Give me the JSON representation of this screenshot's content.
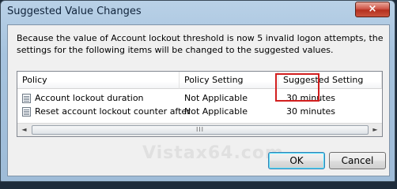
{
  "window": {
    "title": "Suggested Value Changes",
    "close_glyph": "×"
  },
  "message": "Because the value of Account lockout threshold is now 5 invalid logon attempts, the settings for the following items will be changed to the suggested values.",
  "table": {
    "columns": [
      "Policy",
      "Policy Setting",
      "Suggested Setting"
    ],
    "rows": [
      {
        "policy": "Account lockout duration",
        "setting": "Not Applicable",
        "suggested": "30 minutes"
      },
      {
        "policy": "Reset account lockout counter after",
        "setting": "Not Applicable",
        "suggested": "30 minutes"
      }
    ],
    "scroll_left": "◄",
    "scroll_right": "►",
    "scroll_grip": "III"
  },
  "watermark": "Vistax64.com",
  "buttons": {
    "ok": "OK",
    "cancel": "Cancel"
  },
  "colors": {
    "highlight": "#d21f1f"
  }
}
